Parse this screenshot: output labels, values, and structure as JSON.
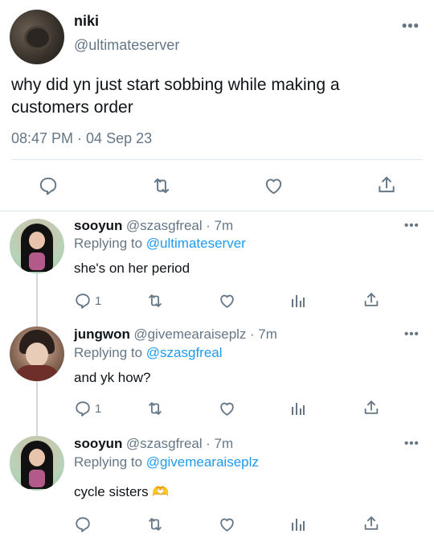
{
  "main_tweet": {
    "name": "niki",
    "handle": "@ultimateserver",
    "text": "why did yn just start sobbing while making a customers order",
    "timestamp": "08:47 PM · 04 Sep 23",
    "more": "•••"
  },
  "replies": [
    {
      "name": "sooyun",
      "handle": "@szasgfreal",
      "time": "· 7m",
      "replying_label": "Replying to",
      "replying_to": "@ultimateserver",
      "text": "she's on her period",
      "reply_count": "1",
      "more": "•••"
    },
    {
      "name": "jungwon",
      "handle": "@givemearaiseplz",
      "time": "· 7m",
      "replying_label": "Replying to",
      "replying_to": "@szasgfreal",
      "text": "and yk how?",
      "reply_count": "1",
      "more": "•••"
    },
    {
      "name": "sooyun",
      "handle": "@szasgfreal",
      "time": "· 7m",
      "replying_label": "Replying to",
      "replying_to": "@givemearaiseplz",
      "text": "cycle sisters 🫶",
      "reply_count": "",
      "more": "•••"
    }
  ],
  "colors": {
    "link": "#1d9bf0",
    "muted": "#657786",
    "divider": "#e1e8ed"
  }
}
